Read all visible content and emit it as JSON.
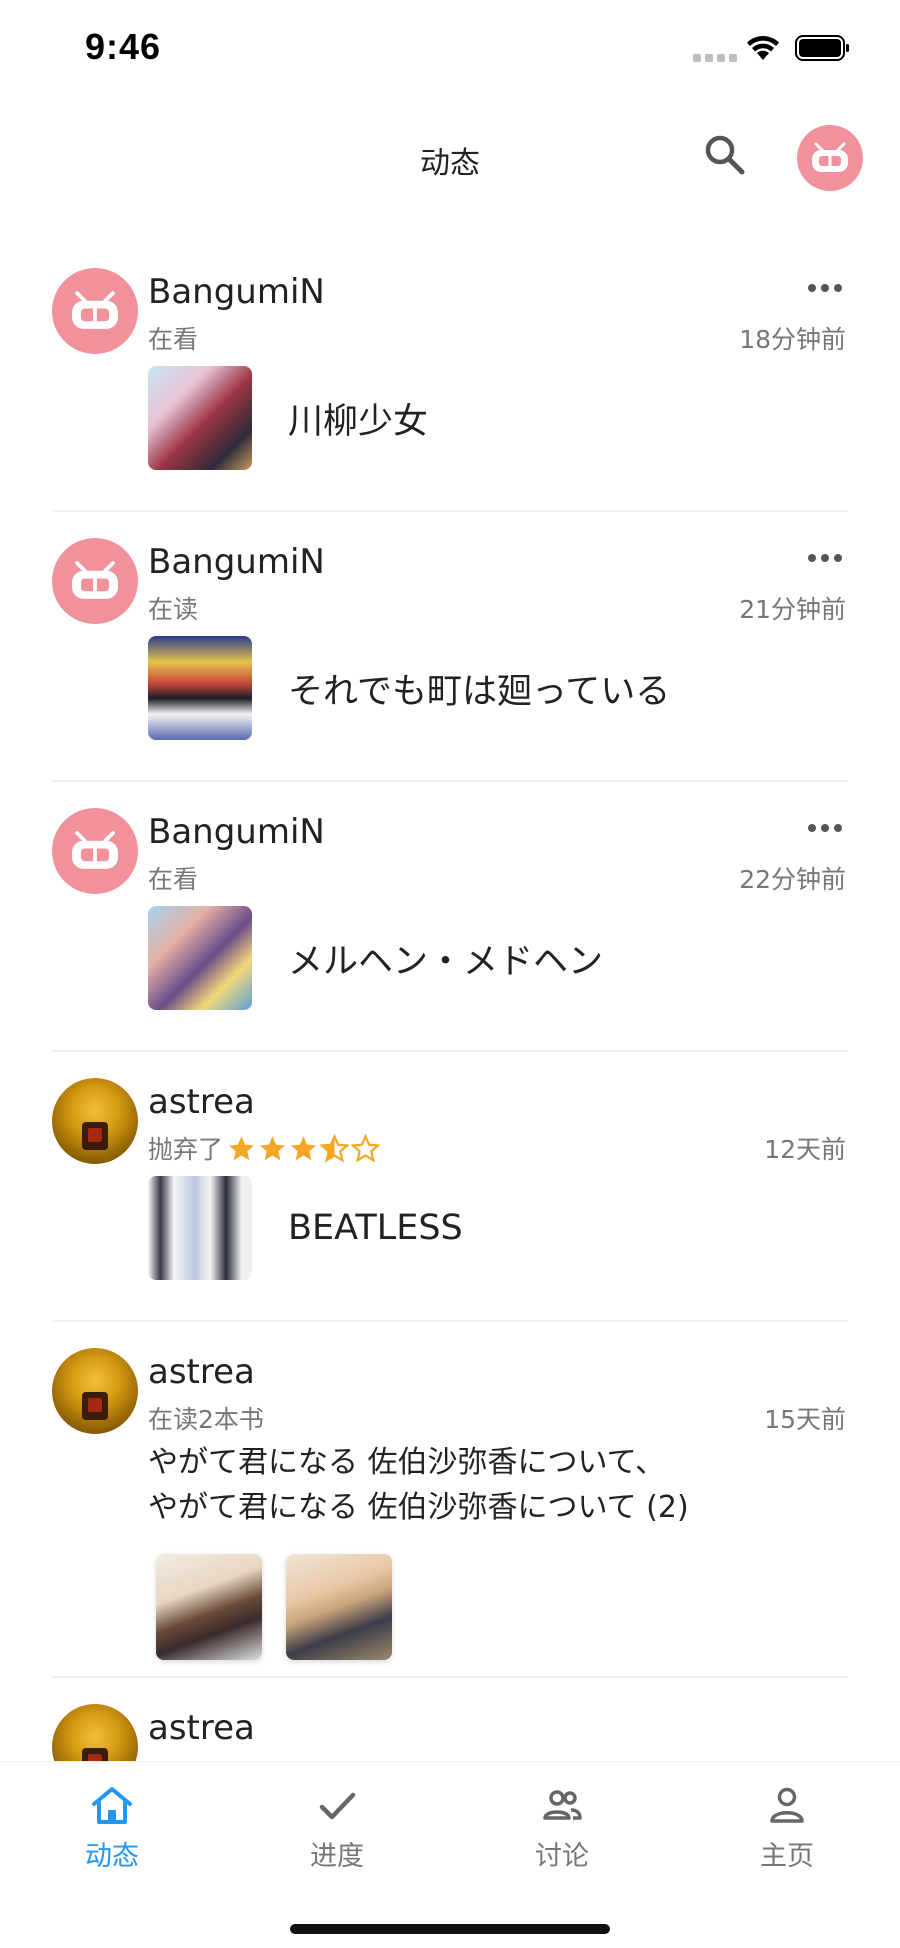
{
  "status_bar": {
    "time": "9:46"
  },
  "header": {
    "title": "动态",
    "search_icon": "search-icon",
    "avatar_icon": "bangumi-logo-icon"
  },
  "feed": [
    {
      "user": "BangumiN",
      "avatar": "bangumi-logo",
      "action": "在看",
      "time": "18分钟前",
      "subject": "川柳少女"
    },
    {
      "user": "BangumiN",
      "avatar": "bangumi-logo",
      "action": "在读",
      "time": "21分钟前",
      "subject": "それでも町は廻っている"
    },
    {
      "user": "BangumiN",
      "avatar": "bangumi-logo",
      "action": "在看",
      "time": "22分钟前",
      "subject": "メルヘン・メドヘン"
    },
    {
      "user": "astrea",
      "avatar": "doll-avatar",
      "action": "抛弃了",
      "rating": 3.5,
      "rating_max": 5,
      "time": "12天前",
      "subject": "BEATLESS"
    },
    {
      "user": "astrea",
      "avatar": "doll-avatar",
      "action": "在读2本书",
      "time": "15天前",
      "lines": [
        "やがて君になる 佐伯沙弥香について、",
        "やがて君になる 佐伯沙弥香について (2)"
      ]
    },
    {
      "user": "astrea",
      "avatar": "doll-avatar"
    }
  ],
  "tabs": [
    {
      "label": "动态",
      "icon": "home-icon",
      "active": true
    },
    {
      "label": "进度",
      "icon": "check-icon",
      "active": false
    },
    {
      "label": "讨论",
      "icon": "people-icon",
      "active": false
    },
    {
      "label": "主页",
      "icon": "person-icon",
      "active": false
    }
  ],
  "colors": {
    "accent": "#2196f3",
    "brand_pink": "#f0919b",
    "star": "#f5a623"
  }
}
